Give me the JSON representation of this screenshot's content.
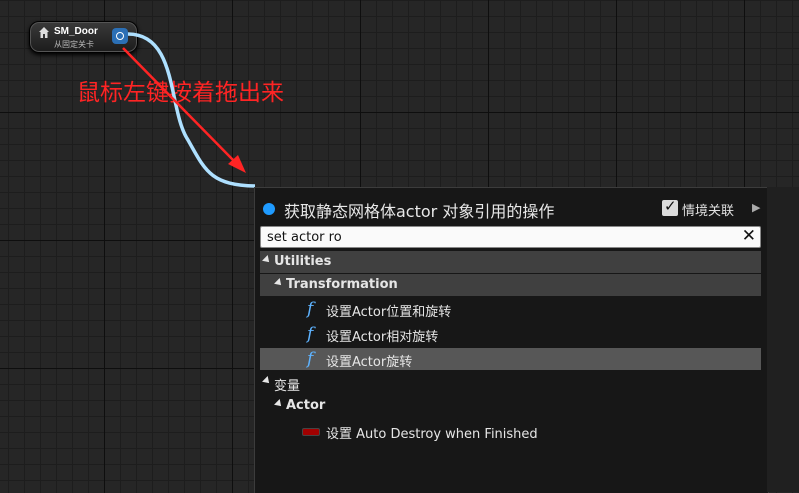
{
  "node": {
    "title": "SM_Door",
    "subtitle": "从固定关卡",
    "icon": "house-icon",
    "pin_color": "#2b6fb5"
  },
  "annotation": {
    "text": "鼠标左键按着拖出来",
    "color": "#ff2424"
  },
  "popup": {
    "title": "获取静态网格体actor 对象引用的操作",
    "context_label": "情境关联",
    "context_checked": true,
    "search_value": "set actor ro",
    "clear_icon": "close-icon"
  },
  "tree": [
    {
      "kind": "category",
      "label": "Utilities"
    },
    {
      "kind": "subcategory",
      "label": "Transformation"
    },
    {
      "kind": "function",
      "label": "设置Actor位置和旋转"
    },
    {
      "kind": "function",
      "label": "设置Actor相对旋转"
    },
    {
      "kind": "function",
      "label": "设置Actor旋转",
      "selected": true
    },
    {
      "kind": "category",
      "label": "变量"
    },
    {
      "kind": "subcategory",
      "label": "Actor"
    },
    {
      "kind": "variable",
      "label": "设置 Auto Destroy when Finished"
    }
  ]
}
